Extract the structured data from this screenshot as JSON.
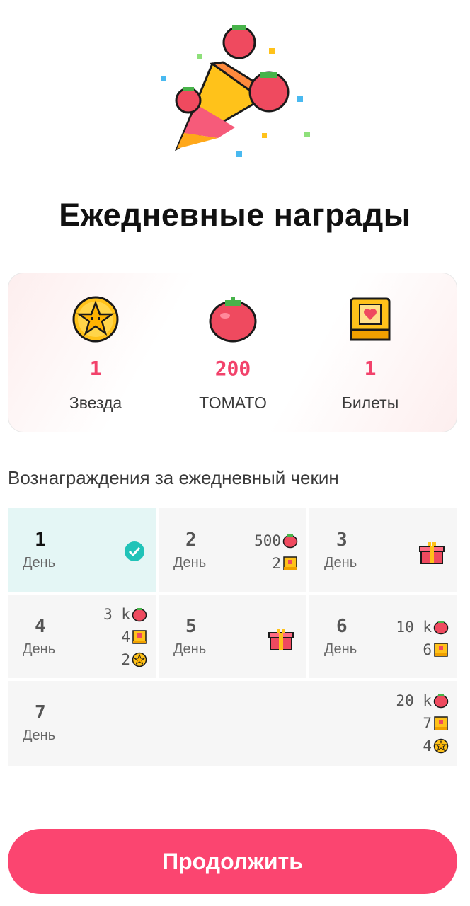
{
  "title": "Ежедневные награды",
  "summary": [
    {
      "icon": "star-coin-icon",
      "value": "1",
      "label": "Звезда"
    },
    {
      "icon": "tomato-icon",
      "value": "200",
      "label": "TOMATO"
    },
    {
      "icon": "ticket-icon",
      "value": "1",
      "label": "Билеты"
    }
  ],
  "section_title": "Вознаграждения за ежедневный чекин",
  "day_label": "День",
  "days": [
    {
      "num": "1",
      "label": "День",
      "status": "claimed"
    },
    {
      "num": "2",
      "label": "День",
      "rewards": [
        {
          "amount": "500",
          "icon": "tomato-icon"
        },
        {
          "amount": "2",
          "icon": "ticket-icon"
        }
      ]
    },
    {
      "num": "3",
      "label": "День",
      "rewards": [
        {
          "icon": "gift-icon"
        }
      ]
    },
    {
      "num": "4",
      "label": "День",
      "rewards": [
        {
          "amount": "3 k",
          "icon": "tomato-icon"
        },
        {
          "amount": "4",
          "icon": "ticket-icon"
        },
        {
          "amount": "2",
          "icon": "star-coin-icon"
        }
      ]
    },
    {
      "num": "5",
      "label": "День",
      "rewards": [
        {
          "icon": "gift-icon"
        }
      ]
    },
    {
      "num": "6",
      "label": "День",
      "rewards": [
        {
          "amount": "10 k",
          "icon": "tomato-icon"
        },
        {
          "amount": "6",
          "icon": "ticket-icon"
        }
      ]
    },
    {
      "num": "7",
      "label": "День",
      "rewards": [
        {
          "amount": "20 k",
          "icon": "tomato-icon"
        },
        {
          "amount": "7",
          "icon": "ticket-icon"
        },
        {
          "amount": "4",
          "icon": "star-coin-icon"
        }
      ]
    }
  ],
  "continue_label": "Продолжить",
  "colors": {
    "accent": "#fb4570",
    "value": "#f2426b",
    "active_cell": "#e4f6f5",
    "check": "#20c3b8"
  }
}
